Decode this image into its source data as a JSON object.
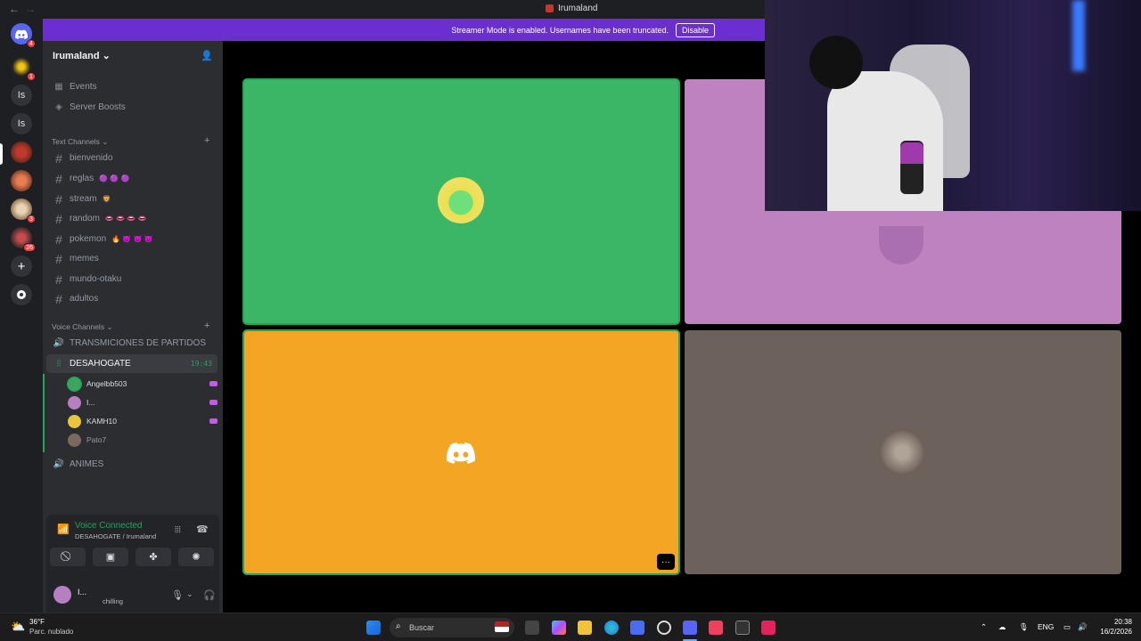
{
  "window": {
    "title": "Irumaland",
    "back": "←",
    "forward": "→"
  },
  "banner": {
    "text": "Streamer Mode is enabled. Usernames have been truncated.",
    "button": "Disable"
  },
  "rail": {
    "servers": [
      {
        "label": "",
        "badge": "4",
        "icon": "discord-home-icon"
      },
      {
        "label": "",
        "badge": "1",
        "icon": "server-avatar"
      },
      {
        "label": "Is",
        "badge": ""
      },
      {
        "label": "Is",
        "badge": ""
      },
      {
        "label": "",
        "badge": "",
        "icon": "server-avatar"
      },
      {
        "label": "",
        "badge": "",
        "icon": "server-avatar"
      },
      {
        "label": "",
        "badge": "3",
        "icon": "server-avatar"
      },
      {
        "label": "",
        "badge": "26",
        "icon": "server-avatar"
      }
    ]
  },
  "guild": {
    "name": "Irumaland"
  },
  "sidebar": {
    "top_items": [
      {
        "label": "Events",
        "icon": "calendar-icon"
      },
      {
        "label": "Server Boosts",
        "icon": "boost-icon"
      }
    ],
    "text_category": "Text Channels",
    "text_channels": [
      {
        "name": "bienvenido",
        "emoji": ""
      },
      {
        "name": "reglas",
        "emoji": "🟣 🟣 🟣"
      },
      {
        "name": "stream",
        "emoji": "🦁"
      },
      {
        "name": "random",
        "emoji": "👄 👄 👄 👄"
      },
      {
        "name": "pokemon",
        "emoji": "🔥 👿 👿 👿"
      },
      {
        "name": "memes",
        "emoji": ""
      },
      {
        "name": "mundo-otaku",
        "emoji": ""
      },
      {
        "name": "adultos",
        "emoji": ""
      }
    ],
    "voice_category": "Voice Channels",
    "voice_channels": [
      {
        "name": "TRANSMICIONES DE PARTIDOS"
      },
      {
        "name": "DESAHOGATE",
        "timer": "19:43"
      },
      {
        "name": "ANIMES"
      }
    ],
    "voice_users": [
      {
        "name": "Angelbb503",
        "color": "#3ba55d"
      },
      {
        "name": "I...",
        "color": "#b77fc2"
      },
      {
        "name": "KAMH10",
        "color": "#e8c53a"
      },
      {
        "name": "Pato7",
        "color": "#7a6a5e"
      }
    ]
  },
  "voice_panel": {
    "status": "Voice Connected",
    "location": "DESAHOGATE / Irumaland",
    "user_name": "I...",
    "user_status": "chilling"
  },
  "tiles": {
    "colors": {
      "green": "#3bb566",
      "pink": "#bd82bf",
      "orange": "#f2a623",
      "taupe": "#6d625b"
    },
    "more_label": "···"
  },
  "taskbar": {
    "weather_temp": "36°F",
    "weather_desc": "Parc. nublado",
    "search_placeholder": "Buscar",
    "language": "ENG",
    "time": "20:38",
    "date": "16/2/2026"
  }
}
